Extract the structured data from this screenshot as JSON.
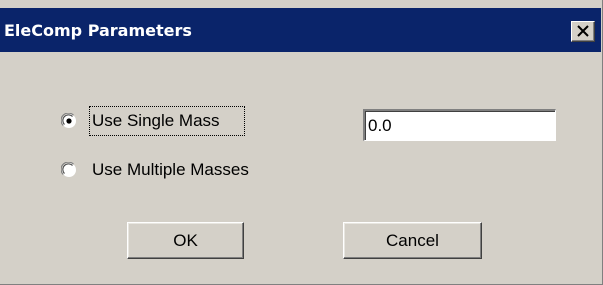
{
  "window": {
    "title": "EleComp Parameters",
    "close_icon": "close-icon"
  },
  "options": {
    "single_mass_label": "Use Single Mass",
    "multiple_masses_label": "Use Multiple Masses",
    "selected": "single_mass"
  },
  "mass_field": {
    "value": "0.0"
  },
  "buttons": {
    "ok_label": "OK",
    "cancel_label": "Cancel"
  },
  "colors": {
    "titlebar": "#0a246a",
    "face": "#d4d0c8"
  }
}
